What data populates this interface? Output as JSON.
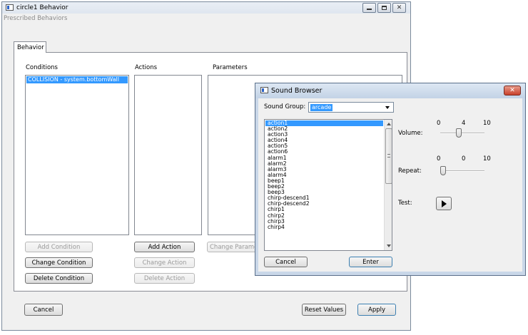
{
  "main_window": {
    "title": "circle1 Behavior",
    "menu": "Prescribed Behaviors",
    "tab": "Behavior",
    "conditions_label": "Conditions",
    "actions_label": "Actions",
    "parameters_label": "Parameters",
    "conditions": [
      "COLLISION - system.bottomWall"
    ],
    "add_condition": "Add Condition",
    "change_condition": "Change Condition",
    "delete_condition": "Delete Condition",
    "add_action": "Add Action",
    "change_action": "Change Action",
    "delete_action": "Delete Action",
    "change_parameter": "Change Parameter",
    "cancel": "Cancel",
    "reset_values": "Reset Values",
    "apply": "Apply"
  },
  "sound_browser": {
    "title": "Sound Browser",
    "sound_group_label": "Sound Group:",
    "sound_group_value": "arcade",
    "sounds": [
      "action1",
      "action2",
      "action3",
      "action4",
      "action5",
      "action6",
      "alarm1",
      "alarm2",
      "alarm3",
      "alarm4",
      "beep1",
      "beep2",
      "beep3",
      "chirp-descend1",
      "chirp-descend2",
      "chirp1",
      "chirp2",
      "chirp3",
      "chirp4"
    ],
    "selected_sound": "action1",
    "volume_label": "Volume:",
    "volume_min": "0",
    "volume_value": "4",
    "volume_max": "10",
    "volume_level": 0.4,
    "repeat_label": "Repeat:",
    "repeat_min": "0",
    "repeat_value": "0",
    "repeat_max": "10",
    "repeat_level": 0.0,
    "test_label": "Test:",
    "cancel": "Cancel",
    "enter": "Enter"
  }
}
